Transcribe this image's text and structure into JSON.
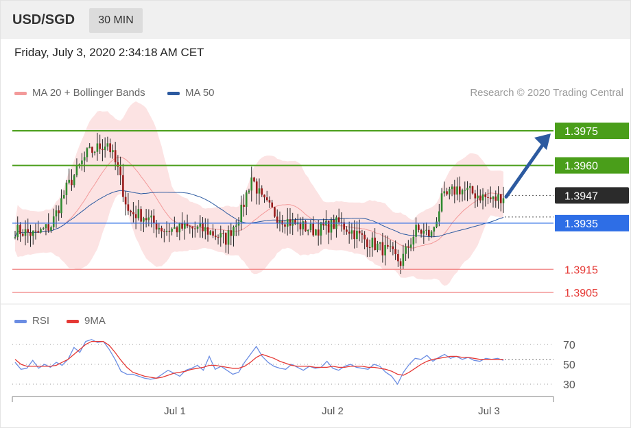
{
  "header": {
    "symbol": "USD/SGD",
    "timeframe": "30 MIN"
  },
  "datetime": "Friday, July 3, 2020 2:34:18 AM CET",
  "legend": {
    "ma20": {
      "label": "MA 20 + Bollinger Bands",
      "color": "#f39a9a"
    },
    "ma50": {
      "label": "MA 50",
      "color": "#2c5aa0"
    }
  },
  "research": "Research © 2020 Trading Central",
  "rsi_legend": {
    "rsi": {
      "label": "RSI",
      "color": "#6b8de3"
    },
    "ma9": {
      "label": "9MA",
      "color": "#e53935"
    }
  },
  "chart_data": [
    {
      "type": "candlestick",
      "ylim": [
        1.3898,
        1.3987
      ],
      "x_labels": [
        "Jul 1",
        "Jul 2",
        "Jul 3"
      ],
      "levels": [
        {
          "label": "1.3975",
          "value": 1.3975,
          "kind": "resistance",
          "color": "#4a9e1a"
        },
        {
          "label": "1.3960",
          "value": 1.396,
          "kind": "resistance",
          "color": "#4a9e1a"
        },
        {
          "label": "1.3947",
          "value": 1.3947,
          "kind": "last",
          "color": "#2b2b2b"
        },
        {
          "label": "1.3935",
          "value": 1.3935,
          "kind": "pivot",
          "color": "#2e6ee6"
        },
        {
          "label": "1.3915",
          "value": 1.3915,
          "kind": "support",
          "color": "#e53935"
        },
        {
          "label": "1.3905",
          "value": 1.3905,
          "kind": "support",
          "color": "#e53935"
        }
      ],
      "target_arrow": {
        "from": 1.3947,
        "to": 1.3975,
        "color": "#2c5aa0"
      }
    },
    {
      "type": "line",
      "title": "RSI",
      "ylim": [
        25,
        80
      ],
      "y_ticks": [
        "70",
        "50",
        "30"
      ],
      "series": [
        {
          "name": "RSI",
          "values": [
            52,
            45,
            46,
            54,
            46,
            50,
            47,
            52,
            49,
            55,
            67,
            62,
            73,
            75,
            72,
            73,
            65,
            55,
            43,
            40,
            40,
            38,
            36,
            35,
            36,
            40,
            44,
            41,
            38,
            44,
            46,
            49,
            44,
            58,
            45,
            48,
            44,
            40,
            42,
            52,
            60,
            68,
            58,
            52,
            48,
            46,
            45,
            50,
            47,
            44,
            48,
            46,
            47,
            53,
            46,
            44,
            48,
            50,
            47,
            46,
            45,
            50,
            48,
            42,
            38,
            30,
            42,
            50,
            56,
            55,
            59,
            53,
            57,
            60,
            56,
            58,
            55,
            57,
            54,
            53,
            56,
            55,
            56,
            54
          ]
        },
        {
          "name": "9MA",
          "values": [
            55,
            50,
            48,
            48,
            48,
            48,
            48,
            49,
            52,
            55,
            60,
            65,
            70,
            73,
            73,
            73,
            69,
            62,
            54,
            47,
            42,
            40,
            38,
            37,
            36,
            37,
            39,
            41,
            42,
            43,
            45,
            46,
            47,
            49,
            49,
            48,
            47,
            46,
            46,
            48,
            52,
            57,
            60,
            58,
            56,
            53,
            51,
            49,
            48,
            48,
            48,
            47,
            47,
            47,
            48,
            47,
            47,
            48,
            48,
            48,
            47,
            47,
            46,
            45,
            43,
            40,
            39,
            42,
            46,
            50,
            53,
            55,
            56,
            57,
            58,
            58,
            57,
            57,
            56,
            55,
            55,
            55,
            55,
            55
          ]
        }
      ]
    }
  ]
}
